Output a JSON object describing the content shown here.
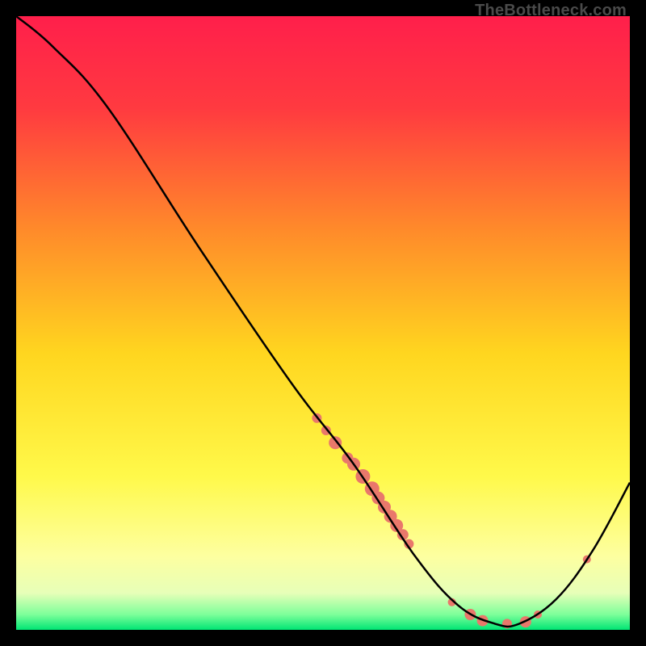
{
  "watermark": "TheBottleneck.com",
  "chart_data": {
    "type": "line",
    "title": "",
    "xlabel": "",
    "ylabel": "",
    "xlim": [
      0,
      100
    ],
    "ylim": [
      0,
      100
    ],
    "curve": [
      {
        "x": 0,
        "y": 100
      },
      {
        "x": 6,
        "y": 95
      },
      {
        "x": 15,
        "y": 85
      },
      {
        "x": 30,
        "y": 62
      },
      {
        "x": 45,
        "y": 40
      },
      {
        "x": 55,
        "y": 27
      },
      {
        "x": 65,
        "y": 12
      },
      {
        "x": 72,
        "y": 4
      },
      {
        "x": 78,
        "y": 1
      },
      {
        "x": 82,
        "y": 1
      },
      {
        "x": 88,
        "y": 5
      },
      {
        "x": 94,
        "y": 13
      },
      {
        "x": 100,
        "y": 24
      }
    ],
    "markers": [
      {
        "x": 49,
        "y": 34.5,
        "r": 6
      },
      {
        "x": 50.5,
        "y": 32.5,
        "r": 6
      },
      {
        "x": 52,
        "y": 30.5,
        "r": 8
      },
      {
        "x": 54,
        "y": 28,
        "r": 7
      },
      {
        "x": 55,
        "y": 27,
        "r": 8
      },
      {
        "x": 56.5,
        "y": 25,
        "r": 9
      },
      {
        "x": 58,
        "y": 23,
        "r": 9
      },
      {
        "x": 59,
        "y": 21.5,
        "r": 8
      },
      {
        "x": 60,
        "y": 20,
        "r": 8
      },
      {
        "x": 61,
        "y": 18.5,
        "r": 8
      },
      {
        "x": 62,
        "y": 17,
        "r": 8
      },
      {
        "x": 63,
        "y": 15.5,
        "r": 7
      },
      {
        "x": 64,
        "y": 14,
        "r": 6
      },
      {
        "x": 71,
        "y": 4.5,
        "r": 5
      },
      {
        "x": 74,
        "y": 2.5,
        "r": 7
      },
      {
        "x": 76,
        "y": 1.5,
        "r": 7
      },
      {
        "x": 80,
        "y": 1,
        "r": 6
      },
      {
        "x": 83,
        "y": 1.3,
        "r": 7
      },
      {
        "x": 85,
        "y": 2.5,
        "r": 5
      },
      {
        "x": 93,
        "y": 11.5,
        "r": 5
      }
    ],
    "gradient_stops": [
      {
        "offset": 0.0,
        "color": "#ff1f4b"
      },
      {
        "offset": 0.15,
        "color": "#ff3a40"
      },
      {
        "offset": 0.35,
        "color": "#ff8b2a"
      },
      {
        "offset": 0.55,
        "color": "#ffd61f"
      },
      {
        "offset": 0.75,
        "color": "#fff94a"
      },
      {
        "offset": 0.88,
        "color": "#fdffa0"
      },
      {
        "offset": 0.94,
        "color": "#e7ffb8"
      },
      {
        "offset": 0.975,
        "color": "#7dff9a"
      },
      {
        "offset": 1.0,
        "color": "#00e574"
      }
    ],
    "marker_fill": "#e9786b",
    "curve_stroke": "#000000"
  }
}
